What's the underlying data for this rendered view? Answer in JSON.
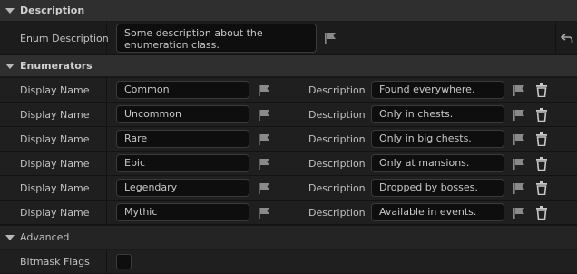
{
  "description_section": {
    "title": "Description",
    "enum_description_label": "Enum Description",
    "enum_description_value": "Some description about the enumeration class."
  },
  "enumerators_section": {
    "title": "Enumerators",
    "display_name_label": "Display Name",
    "description_label": "Description",
    "items": [
      {
        "display_name": "Common",
        "description": "Found everywhere."
      },
      {
        "display_name": "Uncommon",
        "description": "Only in chests."
      },
      {
        "display_name": "Rare",
        "description": "Only in big chests."
      },
      {
        "display_name": "Epic",
        "description": "Only at mansions."
      },
      {
        "display_name": "Legendary",
        "description": "Dropped by bosses."
      },
      {
        "display_name": "Mythic",
        "description": "Available in events."
      }
    ]
  },
  "advanced_section": {
    "title": "Advanced",
    "bitmask_flags_label": "Bitmask Flags",
    "bitmask_flags_checked": false
  },
  "icons": {
    "flag": "flag-icon",
    "trash": "trash-icon",
    "reset": "reset-arrow-icon",
    "collapse": "triangle-down-icon"
  },
  "colors": {
    "accent": "#2b6fd6",
    "background": "#151515",
    "section_header": "#2f2f2f"
  }
}
